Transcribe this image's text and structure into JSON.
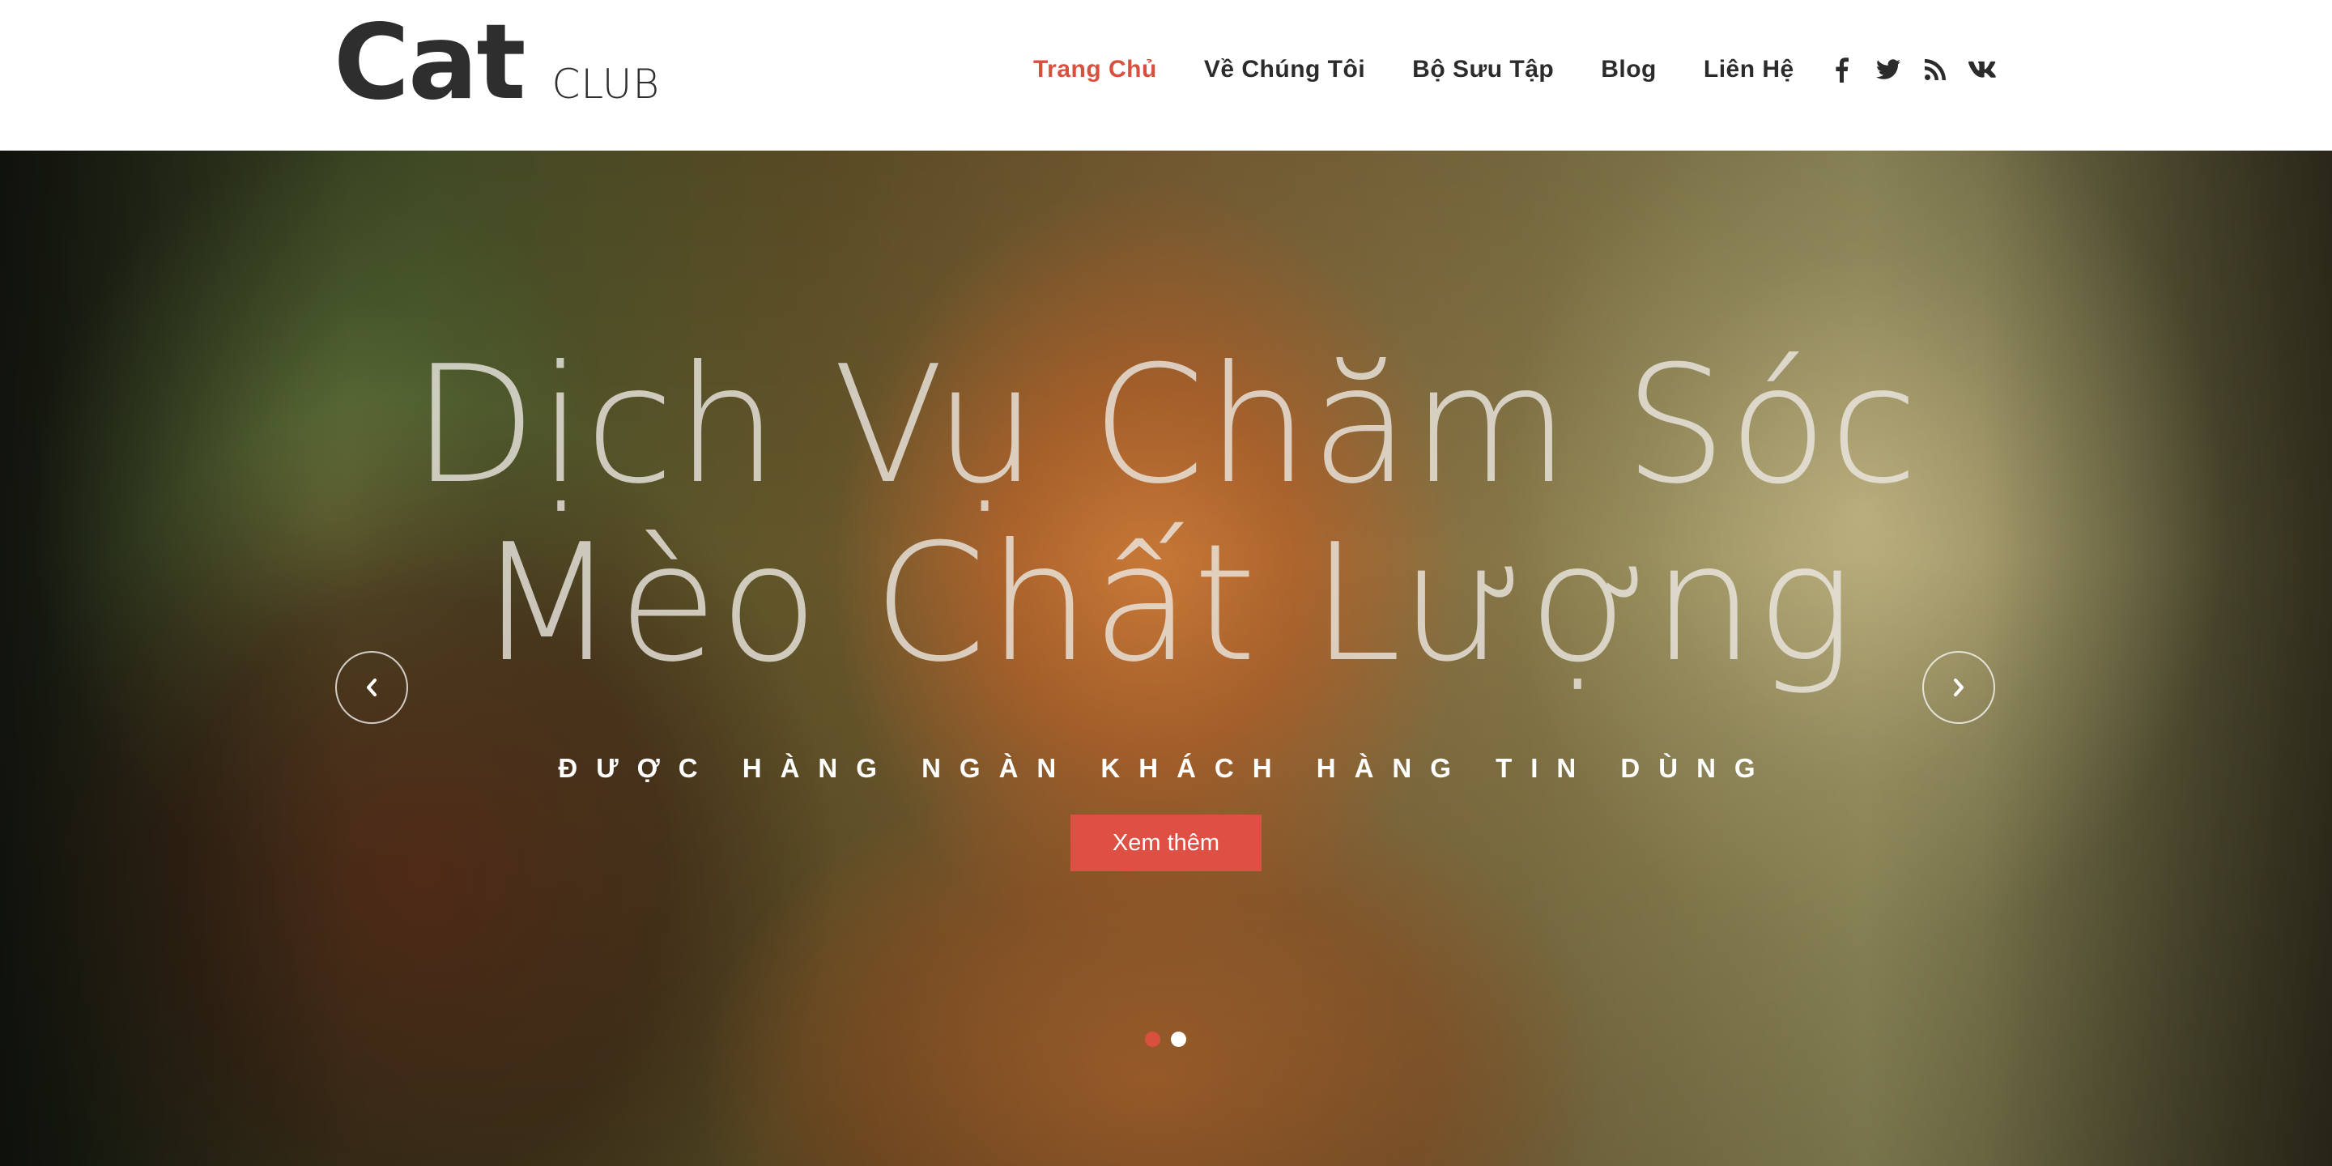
{
  "logo": {
    "main": "Cat",
    "sub": "CLUB"
  },
  "nav": {
    "items": [
      {
        "label": "Trang Chủ",
        "active": true
      },
      {
        "label": "Về Chúng Tôi",
        "active": false
      },
      {
        "label": "Bộ Sưu Tập",
        "active": false
      },
      {
        "label": "Blog",
        "active": false
      },
      {
        "label": "Liên Hệ",
        "active": false
      }
    ]
  },
  "social": [
    "facebook-icon",
    "twitter-icon",
    "rss-icon",
    "vk-icon"
  ],
  "hero": {
    "title_line1": "Dịch Vụ Chăm Sóc",
    "title_line2": "Mèo Chất Lượng",
    "subtitle": "ĐƯỢC HÀNG NGÀN KHÁCH HÀNG TIN DÙNG",
    "button_label": "Xem thêm",
    "slides_count": 2,
    "active_slide": 1
  },
  "colors": {
    "accent": "#d9503f",
    "button": "#de4f44",
    "text_dark": "#2b2b2b",
    "white": "#ffffff"
  }
}
